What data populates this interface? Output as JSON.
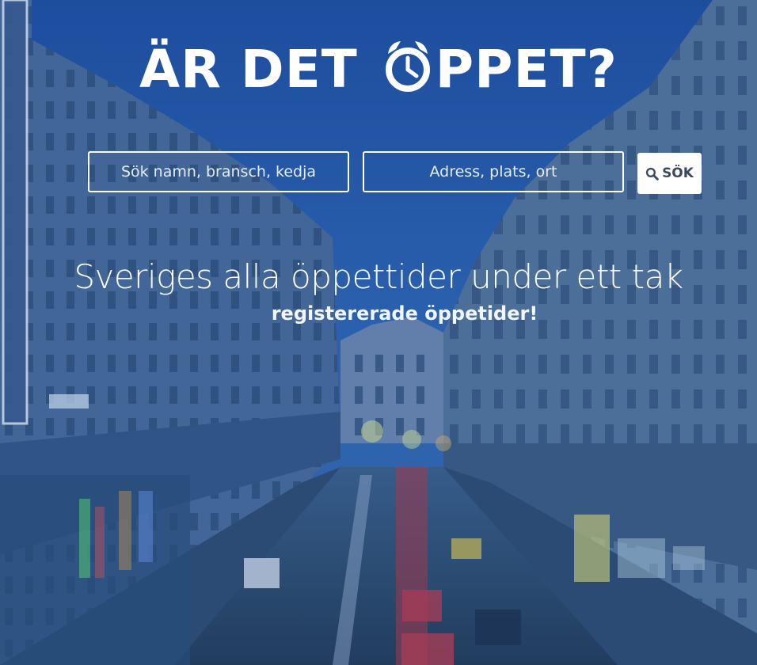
{
  "logo": {
    "part1": "ÄR DET ",
    "clock_icon": "alarm-clock-icon",
    "part2": "PPET?"
  },
  "search": {
    "name_placeholder": "Sök namn, bransch, kedja",
    "place_placeholder": "Adress, plats, ort",
    "button_label": "SÖK",
    "button_icon": "search-icon"
  },
  "tagline": "Sveriges alla öppettider under ett tak",
  "subline": "registererade öppetider!",
  "colors": {
    "overlay": "#2252a0",
    "text": "#ffffff",
    "button_bg": "#ffffff",
    "button_text": "#3a4a5c"
  }
}
